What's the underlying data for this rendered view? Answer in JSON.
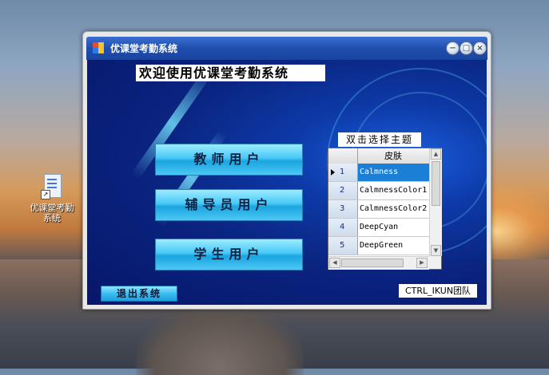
{
  "desktop": {
    "icon_label_line1": "优课堂考勤",
    "icon_label_line2": "系统"
  },
  "window": {
    "title": "优课堂考勤系统",
    "controls": [
      "minimize",
      "maximize",
      "close"
    ]
  },
  "main": {
    "welcome": "欢迎使用优课堂考勤系统",
    "buttons": {
      "teacher": "教师用户",
      "counselor": "辅导员用户",
      "student": "学生用户",
      "exit": "退出系统"
    },
    "theme_label": "双击选择主题",
    "theme_grid": {
      "column": "皮肤",
      "rows": [
        {
          "num": "1",
          "name": "Calmness",
          "selected": true
        },
        {
          "num": "2",
          "name": "CalmnessColor1",
          "selected": false
        },
        {
          "num": "3",
          "name": "CalmnessColor2",
          "selected": false
        },
        {
          "num": "4",
          "name": "DeepCyan",
          "selected": false
        },
        {
          "num": "5",
          "name": "DeepGreen",
          "selected": false
        }
      ]
    },
    "team": "CTRL_IKUN团队"
  },
  "colors": {
    "titlebar": "#1f4fae",
    "client_bg": "#0a2480",
    "button": "#48c8f6",
    "selection": "#1b7fd8"
  }
}
